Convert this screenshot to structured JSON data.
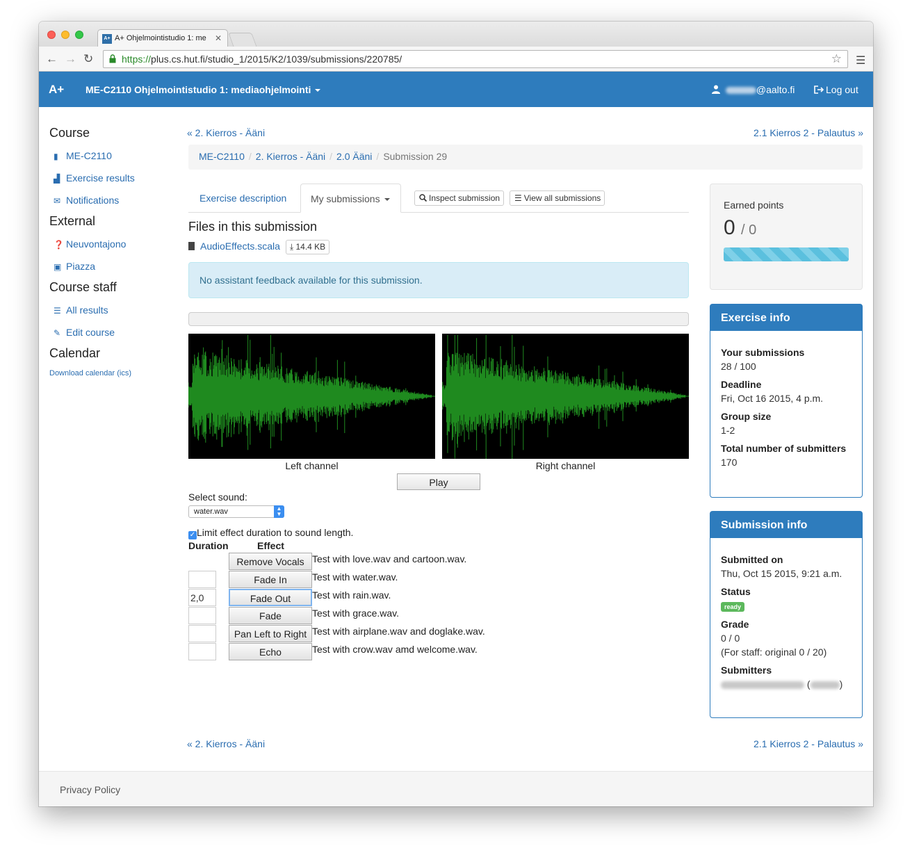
{
  "browser": {
    "tab_title": "A+ Ohjelmointistudio 1: me",
    "tab_favicon": "A+",
    "url_scheme": "https://",
    "url_rest": "plus.cs.hut.fi/studio_1/2015/K2/1039/submissions/220785/"
  },
  "header": {
    "brand": "A+",
    "course": "ME-C2110 Ohjelmointistudio 1: mediaohjelmointi",
    "user_suffix": "@aalto.fi",
    "logout": "Log out"
  },
  "sidebar": {
    "course_heading": "Course",
    "course_items": [
      {
        "label": "ME-C2110",
        "icon": "book-icon"
      },
      {
        "label": "Exercise results",
        "icon": "bar-chart-icon"
      },
      {
        "label": "Notifications",
        "icon": "envelope-icon"
      }
    ],
    "external_heading": "External",
    "external_items": [
      {
        "label": "Neuvontajono",
        "icon": "question-icon"
      },
      {
        "label": "Piazza",
        "icon": "inbox-icon"
      }
    ],
    "staff_heading": "Course staff",
    "staff_items": [
      {
        "label": "All results",
        "icon": "list-icon"
      },
      {
        "label": "Edit course",
        "icon": "pencil-icon"
      }
    ],
    "calendar_heading": "Calendar",
    "calendar_link": "Download calendar (ics)"
  },
  "pager": {
    "prev": "« 2. Kierros - Ääni",
    "next": "2.1 Kierros 2 - Palautus »"
  },
  "breadcrumb": {
    "items": [
      "ME-C2110",
      "2. Kierros - Ääni",
      "2.0 Ääni"
    ],
    "active": "Submission 29"
  },
  "tabs": {
    "exercise_description": "Exercise description",
    "my_submissions": "My submissions",
    "inspect": "Inspect submission",
    "view_all": "View all submissions"
  },
  "files": {
    "heading": "Files in this submission",
    "name": "AudioEffects.scala",
    "size": "14.4 KB"
  },
  "alert": "No assistant feedback available for this submission.",
  "player": {
    "left_label": "Left channel",
    "right_label": "Right channel",
    "play": "Play",
    "select_label": "Select sound:",
    "selected_sound": "water.wav",
    "limit_label": "Limit effect duration to sound length.",
    "col_duration": "Duration",
    "col_effect": "Effect",
    "effects": [
      {
        "button": "Remove Vocals",
        "desc": "Test with love.wav and cartoon.wav.",
        "duration": null
      },
      {
        "button": "Fade In",
        "desc": "Test with water.wav.",
        "duration": ""
      },
      {
        "button": "Fade Out",
        "desc": "Test with rain.wav.",
        "duration": "2,0"
      },
      {
        "button": "Fade",
        "desc": "Test with grace.wav.",
        "duration": ""
      },
      {
        "button": "Pan Left to Right",
        "desc": "Test with airplane.wav and doglake.wav.",
        "duration": ""
      },
      {
        "button": "Echo",
        "desc": "Test with crow.wav amd welcome.wav.",
        "duration": ""
      }
    ],
    "wave_color": "#1f8a1f"
  },
  "points": {
    "label": "Earned points",
    "value": "0",
    "max": "/ 0"
  },
  "exercise_info": {
    "title": "Exercise info",
    "rows": [
      {
        "term": "Your submissions",
        "value": "28 / 100"
      },
      {
        "term": "Deadline",
        "value": "Fri, Oct 16 2015, 4 p.m."
      },
      {
        "term": "Group size",
        "value": "1-2"
      },
      {
        "term": "Total number of submitters",
        "value": "170"
      }
    ]
  },
  "submission_info": {
    "title": "Submission info",
    "submitted_on_term": "Submitted on",
    "submitted_on": "Thu, Oct 15 2015, 9:21 a.m.",
    "status_term": "Status",
    "status": "ready",
    "grade_term": "Grade",
    "grade": "0 / 0",
    "grade_staff": "(For staff: original 0 / 20)",
    "submitters_term": "Submitters"
  },
  "footer": {
    "privacy": "Privacy Policy"
  },
  "colors": {
    "brand_blue": "#2e7cbd",
    "status_green": "#5cb85c",
    "alert_bg": "#d9edf7"
  }
}
